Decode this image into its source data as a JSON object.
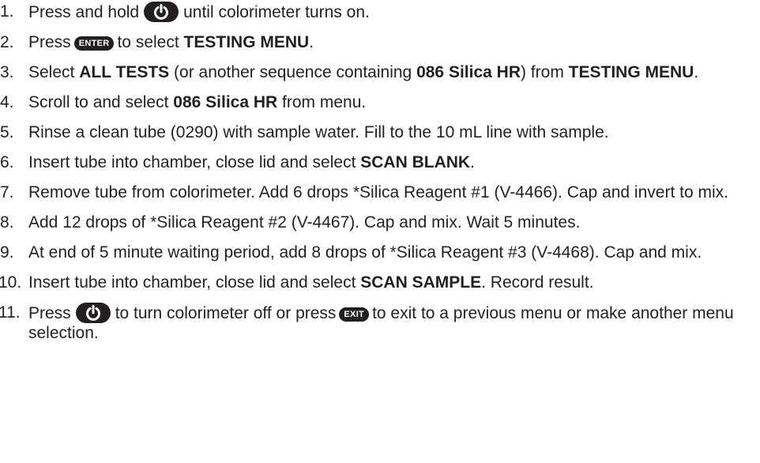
{
  "steps": [
    {
      "num": "1.",
      "pre": "Press and hold",
      "post": "until colorimeter turns on."
    },
    {
      "num": "2.",
      "pre": "Press",
      "key": "ENTER",
      "mid": "to select",
      "bold1": "TESTING MENU",
      "post": "."
    },
    {
      "num": "3.",
      "pre": "Select",
      "bold1": "ALL TESTS",
      "mid": "(or another sequence containing",
      "bold2": "086 Silica HR",
      "mid2": ") from",
      "bold3": "TESTING MENU",
      "post": "."
    },
    {
      "num": "4.",
      "pre": "Scroll to and select",
      "bold1": "086 Silica HR",
      "post": "from menu."
    },
    {
      "num": "5.",
      "text": "Rinse a clean tube (0290) with sample water. Fill to the 10 mL line with sample."
    },
    {
      "num": "6.",
      "pre": "Insert tube into chamber, close lid and select",
      "bold1": "SCAN BLANK",
      "post": "."
    },
    {
      "num": "7.",
      "text": "Remove tube from colorimeter. Add 6 drops *Silica Reagent #1 (V-4466). Cap and invert to mix."
    },
    {
      "num": "8.",
      "text": "Add 12 drops of *Silica Reagent #2 (V-4467). Cap and mix. Wait 5 minutes."
    },
    {
      "num": "9.",
      "text": "At end of 5 minute waiting period, add 8 drops of *Silica Reagent #3 (V-4468). Cap and mix."
    },
    {
      "num": "10.",
      "pre": "Insert tube into chamber, close lid and select",
      "bold1": "SCAN SAMPLE",
      "post": ". Record result."
    },
    {
      "num": "11.",
      "pre": "Press",
      "mid": "to turn colorimeter off or press",
      "key": "EXIT",
      "post": "to exit to a previous menu or make another menu selection."
    }
  ]
}
